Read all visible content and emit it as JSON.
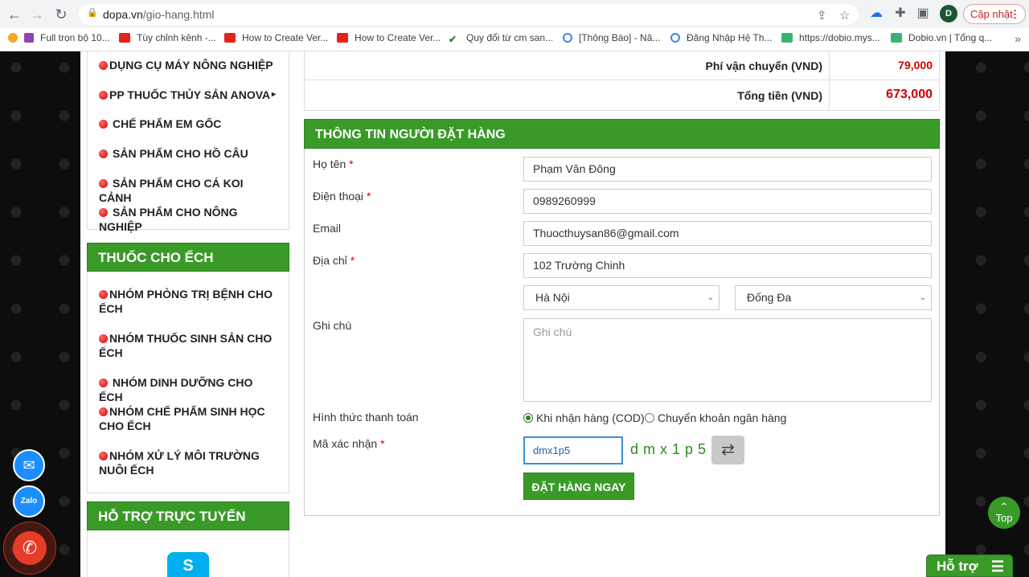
{
  "browser": {
    "url_host": "dopa.vn",
    "url_path": "/gio-hang.html",
    "update_label": "Cập nhật",
    "profile_initial": "D",
    "bookmarks": [
      {
        "label": "Full trọn bộ 10...",
        "icon": "emoji"
      },
      {
        "label": "Tùy chỉnh kênh -...",
        "icon": "youtube"
      },
      {
        "label": "How to Create Ver...",
        "icon": "youtube"
      },
      {
        "label": "How to Create Ver...",
        "icon": "youtube"
      },
      {
        "label": "Quy đổi từ cm san...",
        "icon": "check"
      },
      {
        "label": "[Thông Báo] - Nâ...",
        "icon": "google"
      },
      {
        "label": "Đăng Nhập Hệ Th...",
        "icon": "google"
      },
      {
        "label": "https://dobio.mys...",
        "icon": "s"
      },
      {
        "label": "Dobio.vn | Tổng q...",
        "icon": "s"
      }
    ]
  },
  "sidebar": {
    "categories_top": [
      {
        "label": "DỤNG CỤ MÁY NÔNG NGHIỆP",
        "space": false
      },
      {
        "label": "PP THUỐC THỦY SẢN ANOVA",
        "space": false,
        "arrow": "▸"
      },
      {
        "label": "CHẾ PHẨM EM GỐC",
        "space": true
      },
      {
        "label": "SẢN PHẨM CHO HỒ CÂU",
        "space": true
      },
      {
        "label": "SẢN PHẨM CHO CÁ KOI CẢNH",
        "space": true
      },
      {
        "label": "SẢN PHẨM CHO NÔNG NGHIỆP",
        "space": true
      }
    ],
    "frog_heading": "THUỐC CHO ẾCH",
    "frog_items": [
      {
        "line1": "NHÓM PHÒNG TRỊ BỆNH CHO",
        "line2": "ẾCH"
      },
      {
        "line1": "NHÓM THUỐC SINH SẢN CHO",
        "line2": "ẾCH"
      },
      {
        "line1": " NHÓM DINH DƯỠNG CHO ẾCH",
        "line2": ""
      },
      {
        "line1": "NHÓM CHẾ PHẨM SINH HỌC",
        "line2": "CHO ẾCH"
      },
      {
        "line1": "NHÓM XỬ LÝ MÔI TRƯỜNG",
        "line2": "NUÔI ẾCH"
      }
    ],
    "support_heading": "HỖ TRỢ TRỰC TUYẾN"
  },
  "summary": {
    "shipping_label": "Phí vận chuyển (VND)",
    "shipping_value": "79,000",
    "total_label": "Tổng tiền (VND)",
    "total_value": "673,000"
  },
  "order_form": {
    "heading": "THÔNG TIN NGƯỜI ĐẶT HÀNG",
    "name_label": "Họ tên",
    "name_value": "Phạm Văn Đông",
    "phone_label": "Điện thoại",
    "phone_value": "0989260999",
    "email_label": "Email",
    "email_value": "Thuocthuysan86@gmail.com",
    "address_label": "Địa chỉ",
    "address_value": "102 Trường Chinh",
    "city_value": "Hà Nội",
    "district_value": "Đống Đa",
    "note_label": "Ghi chú",
    "note_placeholder": "Ghi chú",
    "payment_label": "Hình thức thanh toán",
    "payment_cod": "Khi nhận hàng (COD)",
    "payment_bank": "Chuyển khoản ngân hàng",
    "payment_selected": "cod",
    "captcha_label": "Mã xác nhận",
    "captcha_input": "dmx1p5",
    "captcha_code": "dmx1p5",
    "submit_label": "ĐẶT HÀNG NGAY",
    "required_mark": "*"
  },
  "widgets": {
    "zalo_label": "Zalo",
    "top_label": "Top",
    "support_label": "Hỗ trợ"
  },
  "colors": {
    "brand_green": "#3a9a28",
    "price_red": "#cc0000",
    "captcha_green": "#2d8a1f"
  }
}
